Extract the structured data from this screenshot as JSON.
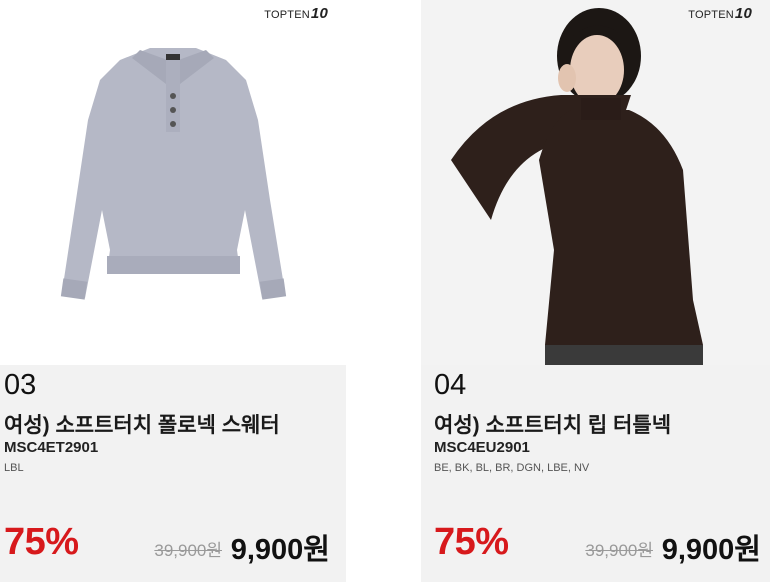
{
  "products": [
    {
      "brand": "TOPTEN",
      "brand_mark": "10",
      "rank": "03",
      "name": "여성) 소프트터치 폴로넥 스웨터",
      "code": "MSC4ET2901",
      "colors": "LBL",
      "discount": "75%",
      "original_price": "39,900원",
      "price": "9,900원",
      "sweater_color": "#b5b8c6"
    },
    {
      "brand": "TOPTEN",
      "brand_mark": "10",
      "rank": "04",
      "name": "여성) 소프트터치 립 터틀넥",
      "code": "MSC4EU2901",
      "colors": "BE, BK, BL, BR, DGN, LBE, NV",
      "discount": "75%",
      "original_price": "39,900원",
      "price": "9,900원",
      "sweater_color": "#2e201b"
    }
  ],
  "accent_color": "#d7191c"
}
